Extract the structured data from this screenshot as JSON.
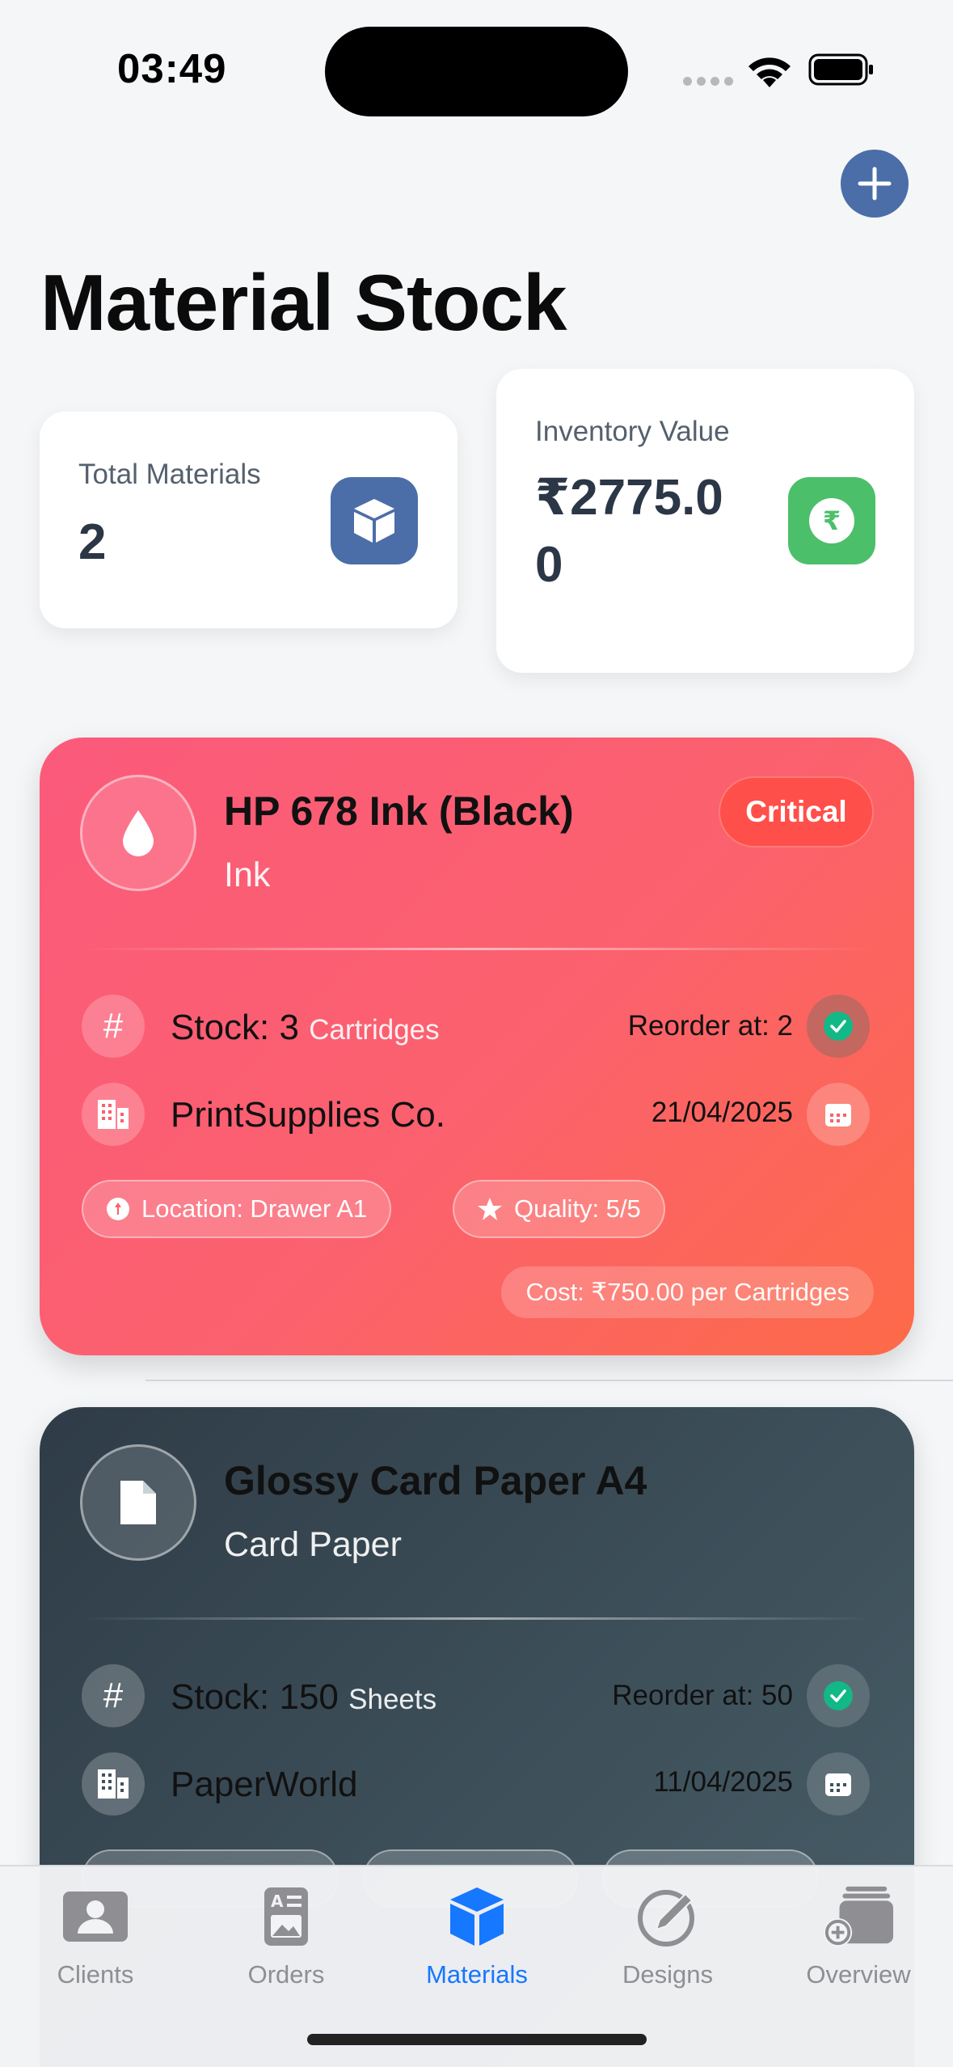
{
  "status_bar": {
    "time": "03:49"
  },
  "page": {
    "title": "Material Stock"
  },
  "stats": {
    "total_materials": {
      "label": "Total Materials",
      "value": "2",
      "icon": "cube-icon",
      "color": "#4b6ea8"
    },
    "inventory_value": {
      "label": "Inventory Value",
      "value_line1": "₹2775.0",
      "value_line2": "0",
      "icon": "rupee-icon",
      "color": "#4cbf6b"
    }
  },
  "materials": [
    {
      "name": "HP 678 Ink (Black)",
      "category": "Ink",
      "icon": "ink-drop-icon",
      "status": "Critical",
      "stock_label": "Stock: 3",
      "unit": "Cartridges",
      "reorder": "Reorder at: 2",
      "supplier": "PrintSupplies Co.",
      "date": "21/04/2025",
      "location": "Location: Drawer A1",
      "quality": "Quality: 5/5",
      "cost": "Cost: ₹750.00 per Cartridges"
    },
    {
      "name": "Glossy Card Paper A4",
      "category": "Card Paper",
      "icon": "document-icon",
      "stock_label": "Stock: 150",
      "unit": "Sheets",
      "reorder": "Reorder at: 50",
      "supplier": "PaperWorld",
      "date": "11/04/2025"
    }
  ],
  "tabs": [
    {
      "label": "Clients",
      "icon": "person-card-icon",
      "active": false
    },
    {
      "label": "Orders",
      "icon": "order-form-icon",
      "active": false
    },
    {
      "label": "Materials",
      "icon": "cube-icon",
      "active": true
    },
    {
      "label": "Designs",
      "icon": "pencil-circle-icon",
      "active": false
    },
    {
      "label": "Overview",
      "icon": "stack-add-icon",
      "active": false
    }
  ],
  "colors": {
    "accent": "#1677ff",
    "critical": "#ff4f4a",
    "check": "#12b886"
  }
}
